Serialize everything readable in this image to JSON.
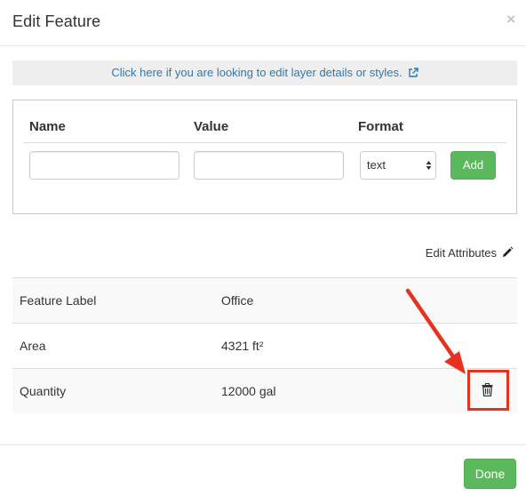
{
  "dialog": {
    "title": "Edit Feature",
    "close_glyph": "×"
  },
  "info_link": {
    "text": "Click here if you are looking to edit layer details or styles.",
    "icon": "external-link-icon"
  },
  "form": {
    "name_header": "Name",
    "value_header": "Value",
    "format_header": "Format",
    "name_value": "",
    "value_value": "",
    "format_selected": "text",
    "add_label": "Add"
  },
  "edit_attributes": {
    "label": "Edit Attributes",
    "icon": "pencil-icon"
  },
  "attributes": [
    {
      "label": "Feature Label",
      "value": "Office"
    },
    {
      "label": "Area",
      "value": "4321 ft²"
    },
    {
      "label": "Quantity",
      "value": "12000 gal"
    }
  ],
  "footer": {
    "done_label": "Done"
  },
  "colors": {
    "accent_green": "#5cb85c",
    "link_blue": "#2a7ab9",
    "annotation_red": "#e8321f"
  }
}
